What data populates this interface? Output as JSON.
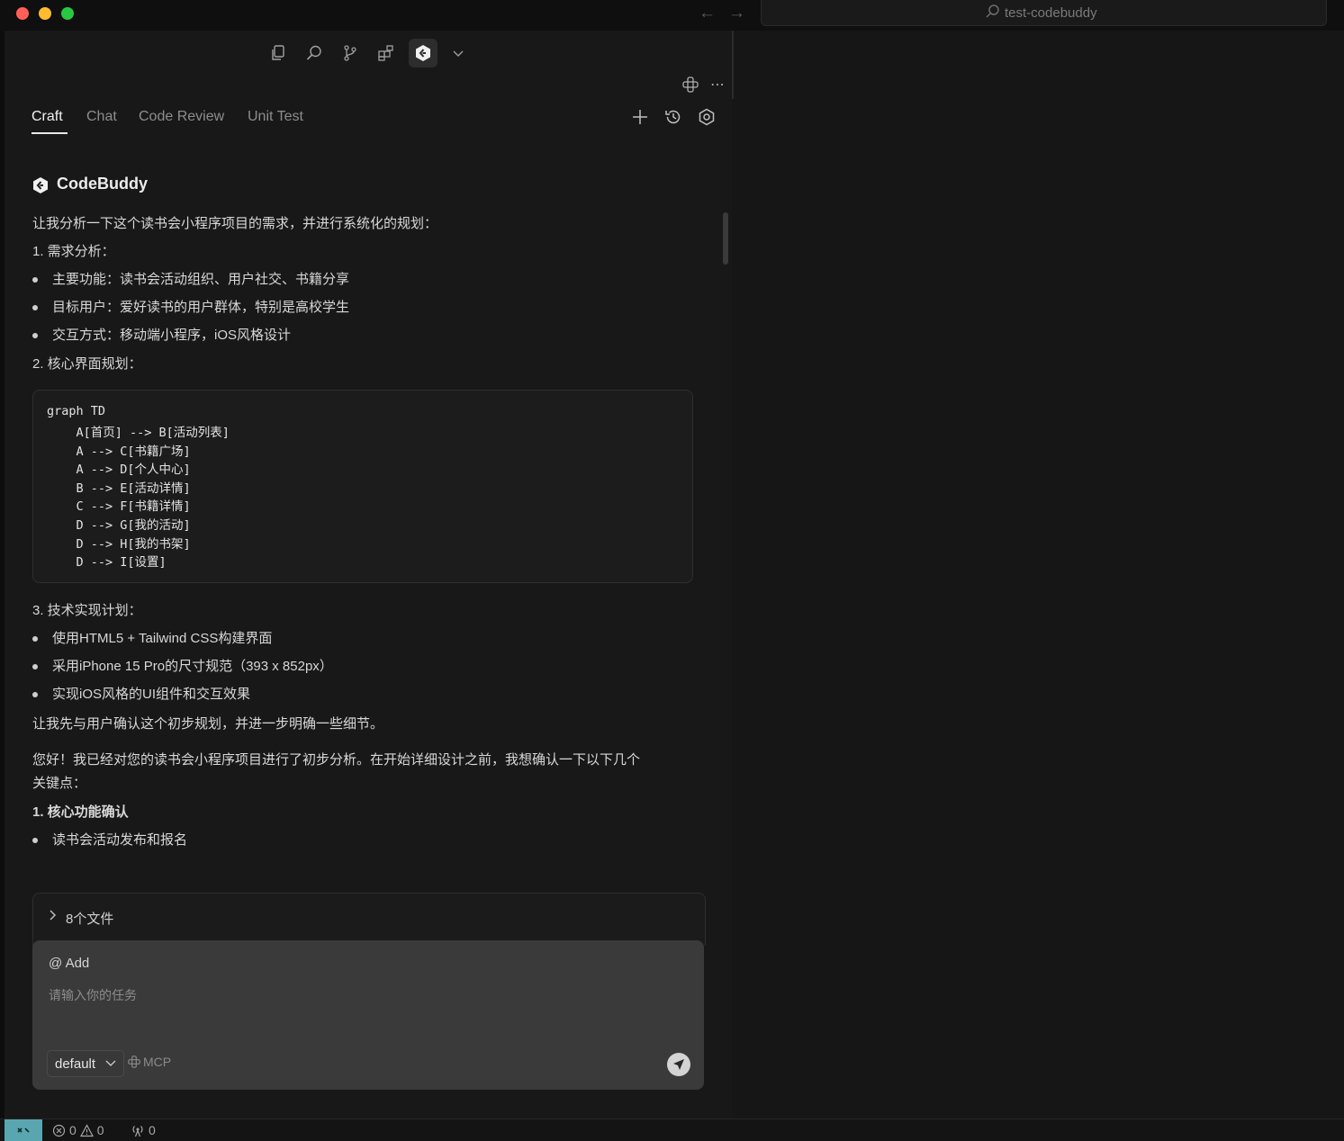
{
  "window": {
    "search_text": "test-codebuddy"
  },
  "activity_bar": {
    "icons": [
      "explorer-icon",
      "search-icon",
      "source-control-icon",
      "extensions-icon",
      "codebuddy-icon",
      "chevron-down-icon"
    ]
  },
  "tabs": [
    {
      "label": "Craft",
      "active": true
    },
    {
      "label": "Chat",
      "active": false
    },
    {
      "label": "Code Review",
      "active": false
    },
    {
      "label": "Unit Test",
      "active": false
    }
  ],
  "assistant": {
    "name": "CodeBuddy",
    "intro": "让我分析一下这个读书会小程序项目的需求，并进行系统化的规划：",
    "section1_title": "1. 需求分析：",
    "section1_bullets": [
      "主要功能：读书会活动组织、用户社交、书籍分享",
      "目标用户：爱好读书的用户群体，特别是高校学生",
      "交互方式：移动端小程序，iOS风格设计"
    ],
    "section2_title": "2. 核心界面规划：",
    "code_lines": [
      "graph TD",
      "    A[首页] --> B[活动列表]",
      "    A --> C[书籍广场]",
      "    A --> D[个人中心]",
      "    B --> E[活动详情]",
      "    C --> F[书籍详情]",
      "    D --> G[我的活动]",
      "    D --> H[我的书架]",
      "    D --> I[设置]"
    ],
    "section3_title": "3. 技术实现计划：",
    "section3_bullets": [
      "使用HTML5 + Tailwind CSS构建界面",
      "采用iPhone 15 Pro的尺寸规范（393 x 852px）",
      "实现iOS风格的UI组件和交互效果"
    ],
    "confirm_line": "让我先与用户确认这个初步规划，并进一步明确一些细节。",
    "greeting_line1": "您好！我已经对您的读书会小程序项目进行了初步分析。在开始详细设计之前，我想确认一下以下几个",
    "greeting_line2": "关键点：",
    "section4_title": "1. 核心功能确认",
    "section4_bullets": [
      "读书会活动发布和报名"
    ]
  },
  "files_bar": {
    "label": "8个文件"
  },
  "input": {
    "add_label": "@ Add",
    "placeholder": "请输入你的任务",
    "mode": "default",
    "mcp_label": "MCP"
  },
  "status": {
    "errors": "0",
    "warnings": "0",
    "ports": "0"
  },
  "colors": {
    "accent_remote": "#5aa6b0",
    "background": "#181818",
    "input_bg": "#3a3a3a"
  }
}
